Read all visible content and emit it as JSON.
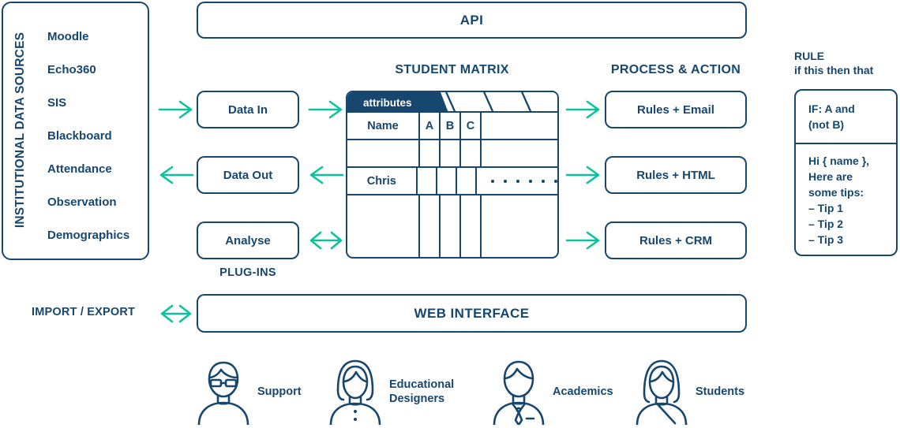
{
  "colors": {
    "navy": "#17466e",
    "green": "#0ac39a",
    "white": "#ffffff"
  },
  "institutional_data_sources": {
    "vertical_label": "INSTITUTIONAL DATA SOURCES",
    "items": [
      {
        "label": "Moodle"
      },
      {
        "label": "Echo360"
      },
      {
        "label": "SIS"
      },
      {
        "label": "Blackboard"
      },
      {
        "label": "Attendance"
      },
      {
        "label": "Observation"
      },
      {
        "label": "Demographics"
      }
    ]
  },
  "top_bar": {
    "api_label": "API"
  },
  "plugins": {
    "group_label": "PLUG-INS",
    "data_in_label": "Data In",
    "data_out_label": "Data Out",
    "analyse_label": "Analyse"
  },
  "student_matrix": {
    "heading": "STUDENT MATRIX",
    "tab_label": "attributes",
    "columns": [
      "Name",
      "A",
      "B",
      "C",
      ""
    ],
    "rows": [
      {
        "name": "",
        "a": "",
        "b": "",
        "c": "",
        "dots": 0
      },
      {
        "name": "Chris",
        "a": "",
        "b": "",
        "c": "",
        "dots": 6
      }
    ]
  },
  "process_action": {
    "heading": "PROCESS & ACTION",
    "items": [
      {
        "label": "Rules + Email"
      },
      {
        "label": "Rules + HTML"
      },
      {
        "label": "Rules + CRM"
      }
    ]
  },
  "rule": {
    "heading_title": "RULE",
    "heading_sub": "if this then that",
    "if_text": "IF: A and\n(not B)",
    "body_text": "Hi { name },\nHere are\nsome tips:\n– Tip 1\n– Tip 2\n– Tip 3"
  },
  "bottom_bar": {
    "import_export_label": "IMPORT / EXPORT",
    "web_interface_label": "WEB INTERFACE"
  },
  "personas": [
    {
      "label": "Support",
      "icon": "person-glasses-icon"
    },
    {
      "label": "Educational\nDesigners",
      "icon": "person-long-hair-icon"
    },
    {
      "label": "Academics",
      "icon": "person-tie-icon"
    },
    {
      "label": "Students",
      "icon": "person-student-icon"
    }
  ]
}
